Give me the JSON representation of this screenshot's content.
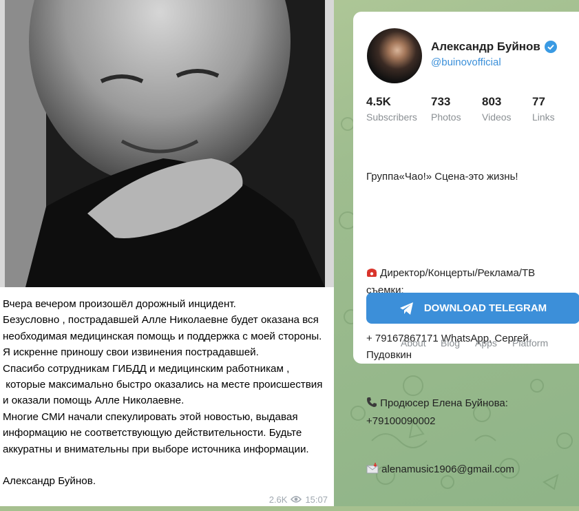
{
  "message": {
    "text": "Вчера вечером произошёл дорожный инцидент.\nБезусловно , пострадавшей Алле Николаевне будет оказана вся необходимая медицинская помощь и поддержка с моей стороны. Я искренне приношу свои извинения пострадавшей.\nСпасибо сотрудникам ГИБДД и медицинским работникам ,\n которые максимально быстро оказались на месте происшествия и оказали помощь Алле Николаевне.\nМногие СМИ начали спекулировать этой новостью, выдавая информацию не соответствующую действительности. Будьте аккуратны и внимательны при выборе источника информации.\n\nАлександр Буйнов.",
    "views": "2.6K",
    "time": "15:07"
  },
  "channel": {
    "title": "Александр Буйнов",
    "handle": "@buinovofficial",
    "stats": [
      {
        "value": "4.5K",
        "label": "Subscribers"
      },
      {
        "value": "733",
        "label": "Photos"
      },
      {
        "value": "803",
        "label": "Videos"
      },
      {
        "value": "77",
        "label": "Links"
      }
    ],
    "description": {
      "line1": "Группа«Чао!» Сцена-это жизнь!",
      "contact_label": " Директор/Концерты/Реклама/ТВ съемки:",
      "contact_phone": "+ 79167867171 WhatsApp, Сергей Пудовкин",
      "producer": " Продюсер Елена Буйнова: +79100090002",
      "email": " alenamusic1906@gmail.com"
    },
    "download_label": "DOWNLOAD TELEGRAM",
    "footer_links": [
      "About",
      "Blog",
      "Apps",
      "Platform"
    ]
  },
  "colors": {
    "accent": "#3c8fd9",
    "link": "#3a8fd9",
    "verified": "#3a9ae3"
  }
}
